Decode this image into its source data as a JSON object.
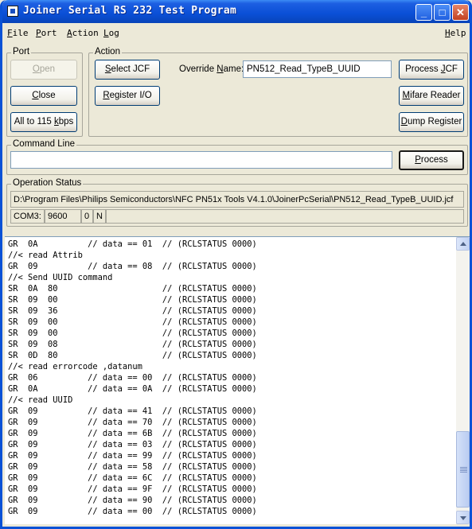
{
  "window": {
    "title": "Joiner Serial RS 232 Test Program"
  },
  "titlebar_buttons": {
    "minimize": "_",
    "maximize": "□",
    "close": "✕"
  },
  "menu": {
    "file": {
      "key": "F",
      "rest": "ile"
    },
    "port": {
      "key": "P",
      "rest": "ort"
    },
    "action": {
      "key": "A",
      "rest": "ction"
    },
    "log": {
      "key": "L",
      "rest": "og"
    },
    "help": {
      "key": "H",
      "rest": "elp"
    }
  },
  "port": {
    "legend": "Port",
    "open": {
      "pre": "",
      "key": "O",
      "post": "pen"
    },
    "close": {
      "pre": "",
      "key": "C",
      "post": "lose"
    },
    "baud": {
      "pre": "All to 115 ",
      "key": "k",
      "post": "bps"
    }
  },
  "action": {
    "legend": "Action",
    "select_jcf": {
      "pre": "",
      "key": "S",
      "post": "elect JCF"
    },
    "register_io": {
      "pre": "",
      "key": "R",
      "post": "egister I/O"
    },
    "override_label": {
      "pre": "Override ",
      "key": "N",
      "post": "ame:"
    },
    "override_value": "PN512_Read_TypeB_UUID",
    "process_jcf": {
      "pre": "Process ",
      "key": "J",
      "post": "CF"
    },
    "mifare_reader": {
      "pre": "",
      "key": "M",
      "post": "ifare Reader"
    },
    "dump_register": {
      "pre": "",
      "key": "D",
      "post": "ump Register"
    }
  },
  "command_line": {
    "legend": "Command Line",
    "value": "",
    "process": {
      "pre": "",
      "key": "P",
      "post": "rocess"
    }
  },
  "operation_status": {
    "legend": "Operation Status",
    "path": "D:\\Program Files\\Philips Semiconductors\\NFC PN51x Tools V4.1.0\\JoinerPcSerial\\PN512_Read_TypeB_UUID.jcf",
    "port": "COM3:",
    "baud": "9600",
    "parity_bits": "0",
    "parity": "N"
  },
  "log": {
    "lines": [
      "GR  0A          // data == 01  // (RCLSTATUS 0000)",
      "//< read Attrib",
      "GR  09          // data == 08  // (RCLSTATUS 0000)",
      "//< Send UUID command",
      "SR  0A  80                     // (RCLSTATUS 0000)",
      "SR  09  00                     // (RCLSTATUS 0000)",
      "SR  09  36                     // (RCLSTATUS 0000)",
      "SR  09  00                     // (RCLSTATUS 0000)",
      "SR  09  00                     // (RCLSTATUS 0000)",
      "SR  09  08                     // (RCLSTATUS 0000)",
      "SR  0D  80                     // (RCLSTATUS 0000)",
      "//< read errorcode ,datanum",
      "GR  06          // data == 00  // (RCLSTATUS 0000)",
      "GR  0A          // data == 0A  // (RCLSTATUS 0000)",
      "//< read UUID",
      "GR  09          // data == 41  // (RCLSTATUS 0000)",
      "GR  09          // data == 70  // (RCLSTATUS 0000)",
      "GR  09          // data == 6B  // (RCLSTATUS 0000)",
      "GR  09          // data == 03  // (RCLSTATUS 0000)",
      "GR  09          // data == 99  // (RCLSTATUS 0000)",
      "GR  09          // data == 58  // (RCLSTATUS 0000)",
      "GR  09          // data == 6C  // (RCLSTATUS 0000)",
      "GR  09          // data == 9F  // (RCLSTATUS 0000)",
      "GR  09          // data == 90  // (RCLSTATUS 0000)",
      "GR  09          // data == 00  // (RCLSTATUS 0000)"
    ]
  }
}
